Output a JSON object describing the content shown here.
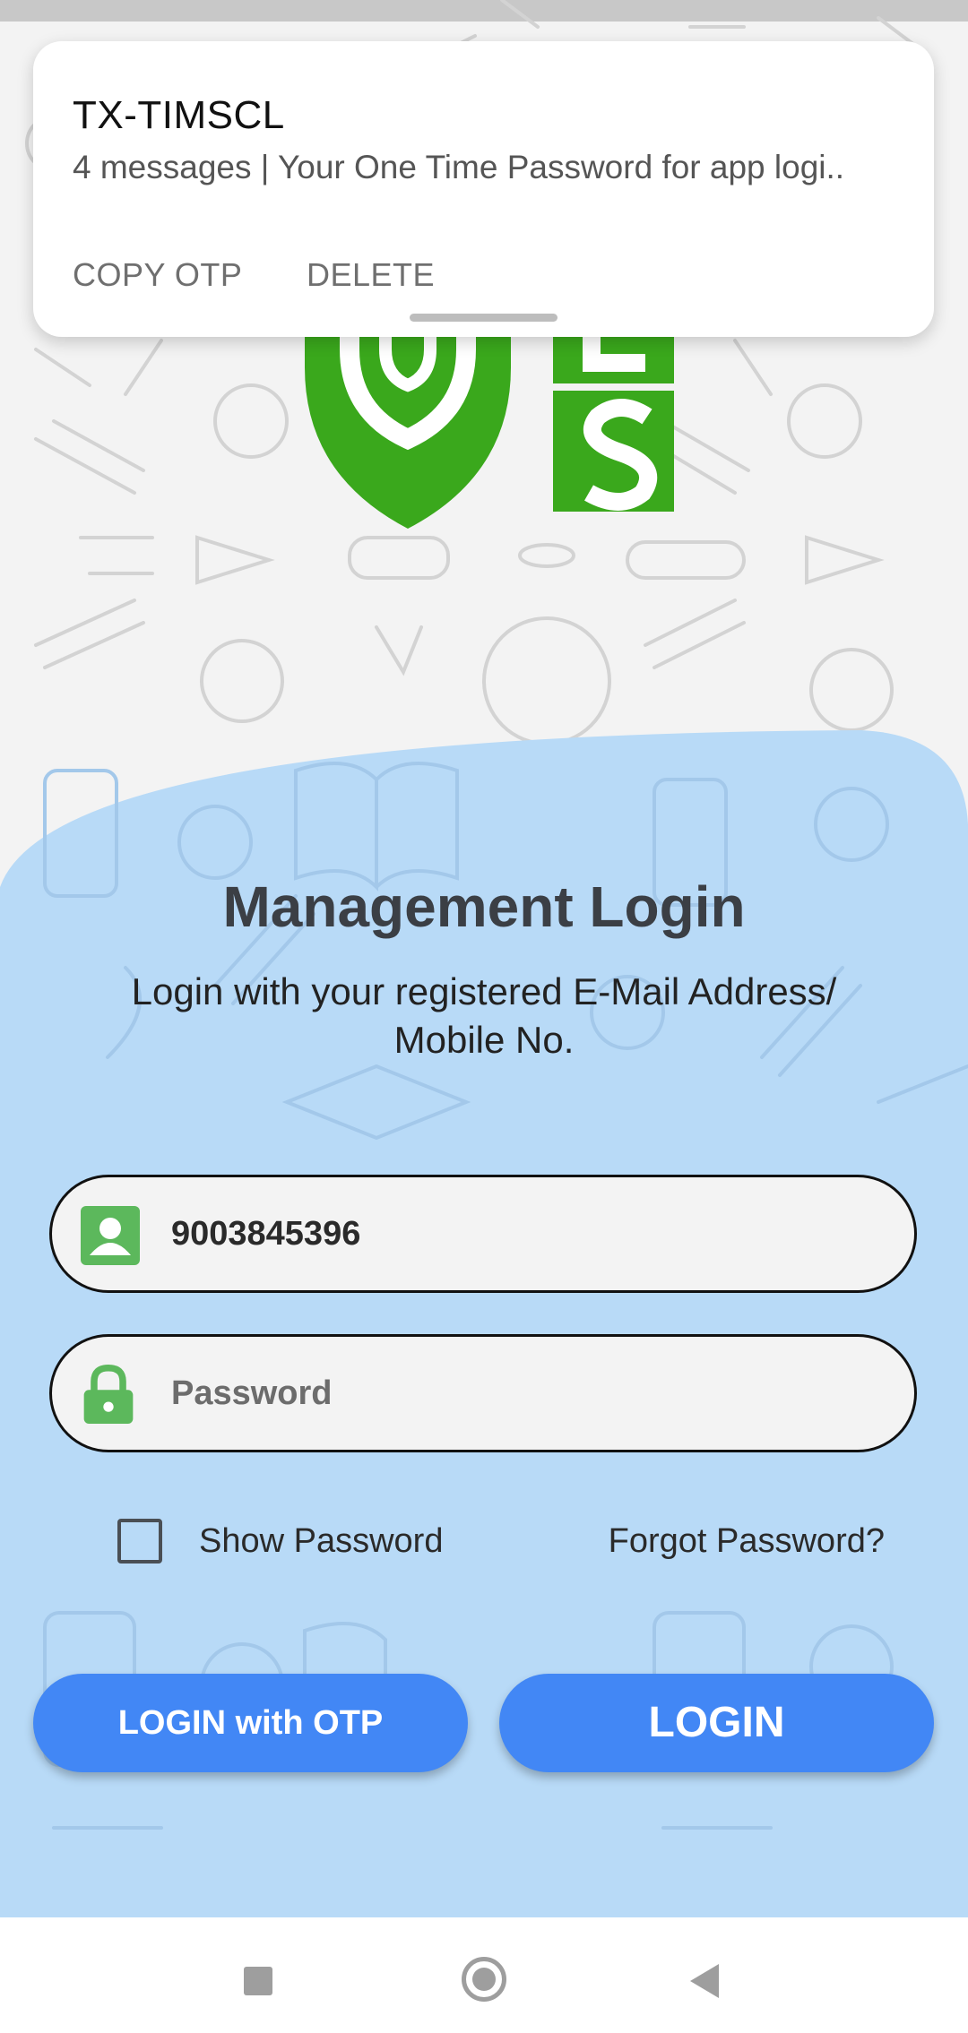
{
  "notification": {
    "sender": "TX-TIMSCL",
    "body": "4 messages | Your One Time Password for app logi..",
    "actions": [
      "COPY OTP",
      "DELETE"
    ]
  },
  "login": {
    "title": "Management Login",
    "subtitle": "Login with your registered E-Mail Address/ Mobile No.",
    "username_value": "9003845396",
    "password_placeholder": "Password",
    "show_password_label": "Show Password",
    "forgot_password_label": "Forgot Password?",
    "otp_button_label": "LOGIN with OTP",
    "login_button_label": "LOGIN"
  },
  "icons": {
    "user": "contact-card-icon",
    "password": "lock-icon",
    "nav_recents": "square-icon",
    "nav_home": "home-circle-icon",
    "nav_back": "back-triangle-icon"
  },
  "colors": {
    "accent_blue": "#4287f5",
    "card_blue": "#b8daf7",
    "icon_green": "#5cb85c",
    "logo_green": "#3aa81c"
  }
}
